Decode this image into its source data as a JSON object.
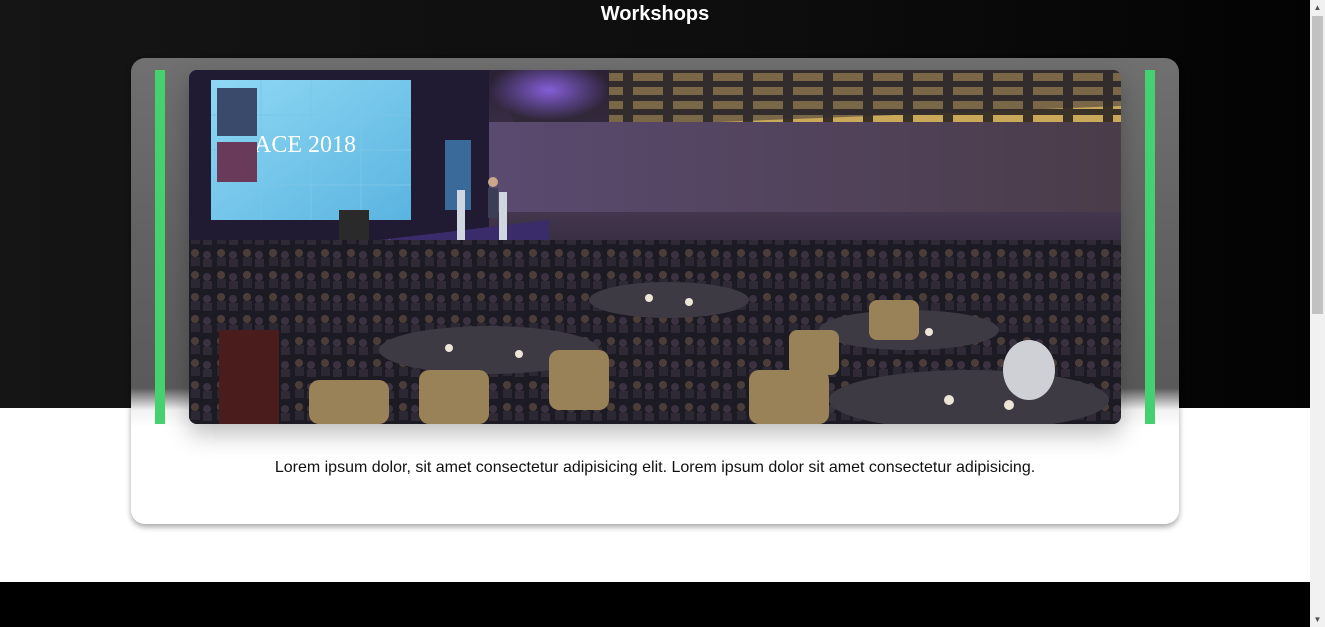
{
  "section": {
    "title": "Workshops"
  },
  "card": {
    "image_alt": "Conference ballroom with stage and audience",
    "screen_text": "ACE 2018",
    "description": "Lorem ipsum dolor, sit amet consectetur adipisicing elit. Lorem ipsum dolor sit amet consectetur adipisicing."
  },
  "colors": {
    "accent": "#45d16f",
    "hero_background": "#111111",
    "footer": "#000000"
  },
  "scrollbar": {
    "up_icon": "triangle-up",
    "down_icon": "triangle-down",
    "position_fraction": 0
  }
}
